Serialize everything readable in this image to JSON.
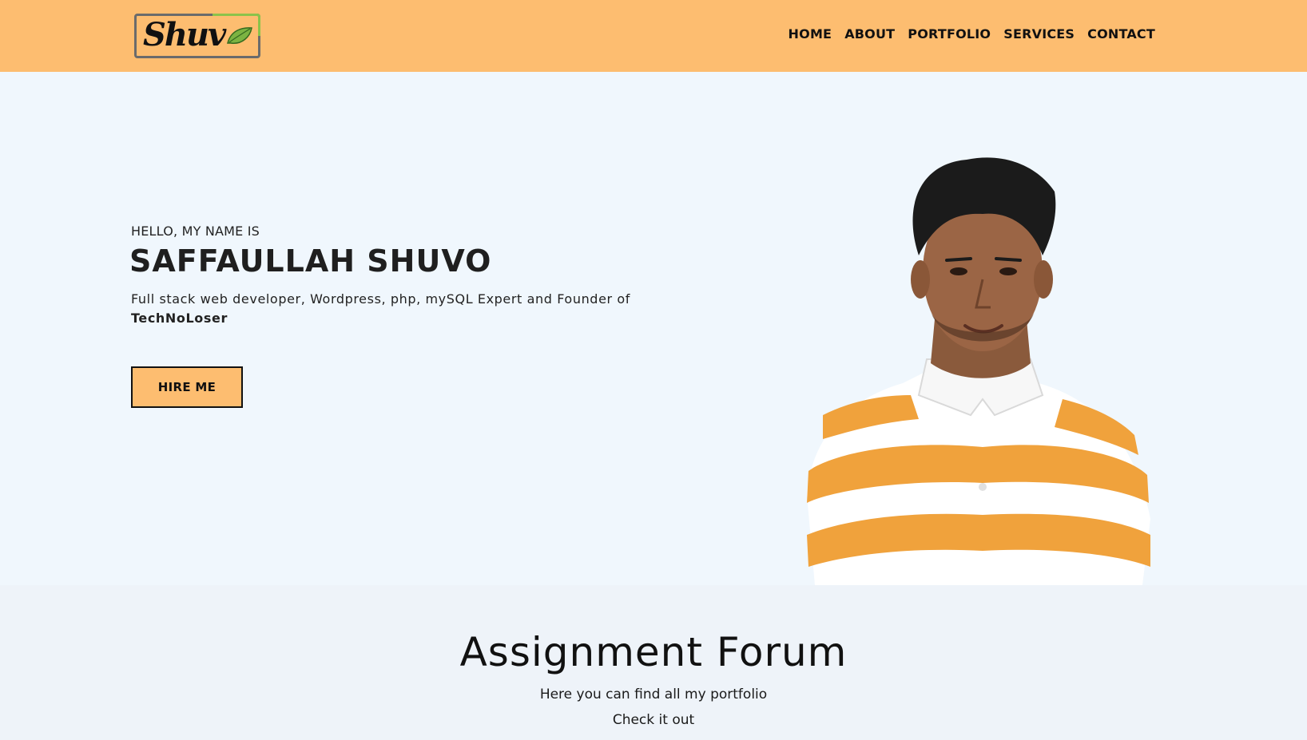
{
  "header": {
    "logo_text": "Shuv",
    "nav": [
      "HOME",
      "ABOUT",
      "PORTFOLIO",
      "SERVICES",
      "CONTACT"
    ]
  },
  "hero": {
    "greeting": "HELLO, MY NAME IS",
    "name": "SAFFAULLAH SHUVO",
    "description": "Full stack web developer, Wordpress, php, mySQL Expert and Founder of",
    "brand": "TechNoLoser",
    "cta_label": "HIRE ME"
  },
  "portfolio_section": {
    "title": "Assignment Forum",
    "subtitle": "Here you can find all my portfolio",
    "subtitle2": "Check it out"
  },
  "colors": {
    "accent": "#fdbd70",
    "hero_bg": "#f0f7fd",
    "section_bg": "#eef3f9",
    "text": "#111111"
  },
  "icons": {
    "logo_leaf": "leaf-icon"
  }
}
